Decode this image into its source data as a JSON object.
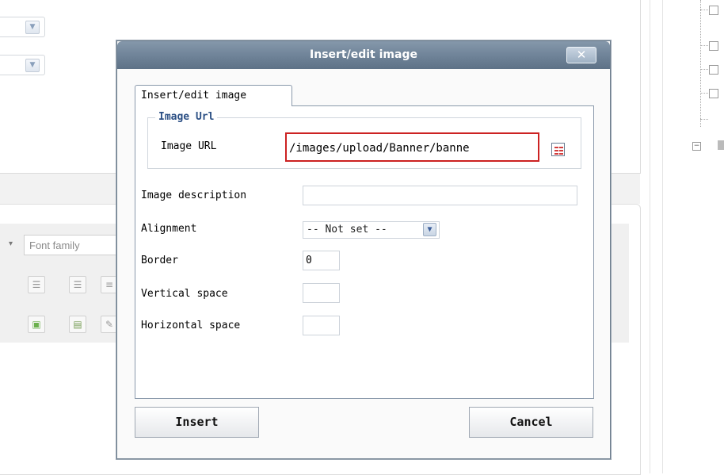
{
  "background": {
    "toolbar": {
      "font_family_placeholder": "Font family",
      "dropdown_arrow": "▾",
      "buttons": [
        "outdent-icon",
        "indent-icon",
        "justify-icon",
        "insert-image-icon",
        "page-break-icon",
        "edit-icon"
      ]
    },
    "tree": {
      "collapse_symbol": "−"
    }
  },
  "dialog": {
    "title": "Insert/edit image",
    "close_label": "✕",
    "tab_label": "Insert/edit image",
    "section_legend": "Image Url",
    "fields": {
      "image_url_label": "Image URL",
      "image_url_value": "/images/upload/Banner/banne",
      "image_description_label": "Image description",
      "image_description_value": "",
      "alignment_label": "Alignment",
      "alignment_value": "-- Not set --",
      "border_label": "Border",
      "border_value": "0",
      "vertical_space_label": "Vertical space",
      "vertical_space_value": "",
      "horizontal_space_label": "Horizontal space",
      "horizontal_space_value": ""
    },
    "insert_label": "Insert",
    "cancel_label": "Cancel"
  },
  "colors": {
    "titlebar": "#6e8297",
    "legend_text": "#2b4f84",
    "highlight": "#cc2222"
  }
}
